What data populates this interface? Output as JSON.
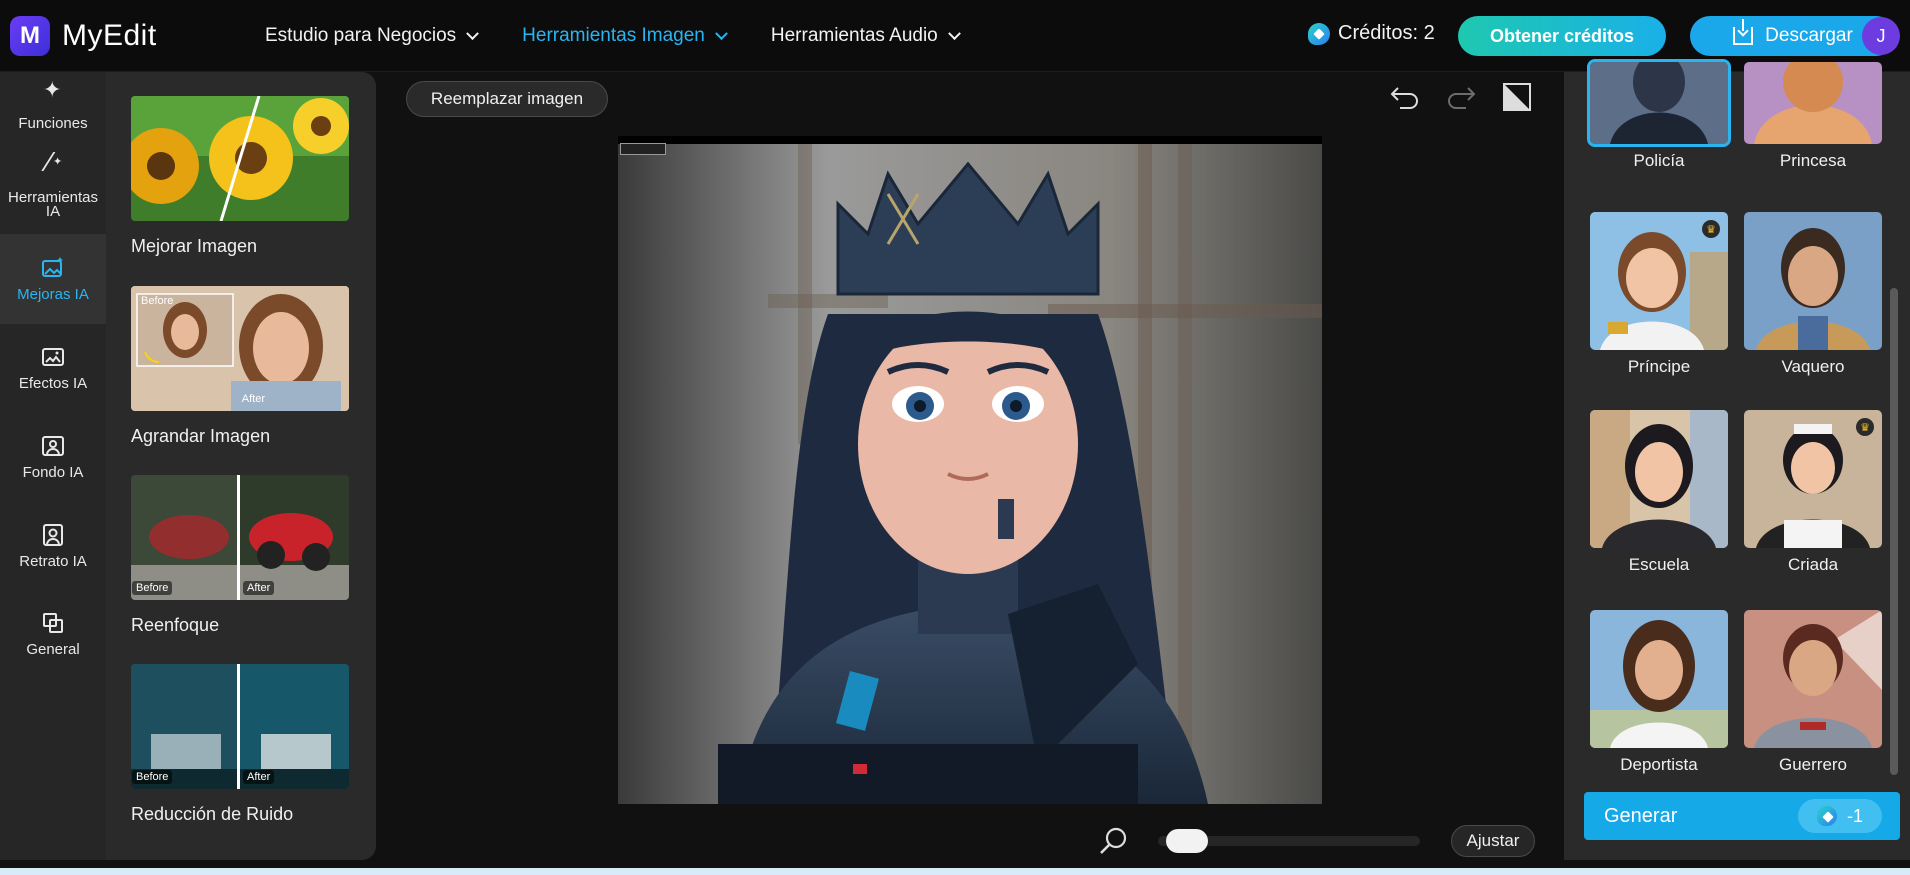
{
  "brand": {
    "logo_letter": "M",
    "name": "MyEdit"
  },
  "nav": {
    "items": [
      {
        "label": "Estudio para Negocios",
        "active": false
      },
      {
        "label": "Herramientas Imagen",
        "active": true
      },
      {
        "label": "Herramientas Audio",
        "active": false
      }
    ]
  },
  "header": {
    "credits_label": "Créditos: 2",
    "get_credits_label": "Obtener créditos",
    "download_label": "Descargar",
    "avatar_initial": "J"
  },
  "rail": {
    "items": [
      {
        "label": "Funciones",
        "icon": "sparkles-icon"
      },
      {
        "label": "Herramientas IA",
        "icon": "magic-wand-icon"
      },
      {
        "label": "Mejoras IA",
        "icon": "image-enhance-icon",
        "active": true
      },
      {
        "label": "Efectos IA",
        "icon": "image-effects-icon"
      },
      {
        "label": "Fondo IA",
        "icon": "background-icon"
      },
      {
        "label": "Retrato IA",
        "icon": "portrait-icon"
      },
      {
        "label": "General",
        "icon": "general-icon"
      }
    ]
  },
  "tools": {
    "items": [
      {
        "label": "Mejorar Imagen"
      },
      {
        "label": "Agrandar Imagen",
        "before": "Before",
        "after": "After"
      },
      {
        "label": "Reenfoque",
        "before": "Before",
        "after": "After"
      },
      {
        "label": "Reducción de Ruido",
        "before": "Before",
        "after": "After"
      }
    ]
  },
  "canvas": {
    "replace_label": "Reemplazar imagen",
    "fit_label": "Ajustar",
    "zoom_level": 0.05
  },
  "styles": {
    "items": [
      {
        "label": "Policía",
        "selected": true,
        "premium": false
      },
      {
        "label": "Princesa",
        "selected": false,
        "premium": false
      },
      {
        "label": "Príncipe",
        "selected": false,
        "premium": true
      },
      {
        "label": "Vaquero",
        "selected": false,
        "premium": false
      },
      {
        "label": "Escuela",
        "selected": false,
        "premium": false
      },
      {
        "label": "Criada",
        "selected": false,
        "premium": true
      },
      {
        "label": "Deportista",
        "selected": false,
        "premium": false
      },
      {
        "label": "Guerrero",
        "selected": false,
        "premium": false
      }
    ]
  },
  "generate": {
    "label": "Generar",
    "cost": "-1"
  },
  "colors": {
    "accent": "#15a9e8",
    "active_nav": "#2ab4f0",
    "panel": "#2a2a2a",
    "brand": "#5b36e8"
  }
}
